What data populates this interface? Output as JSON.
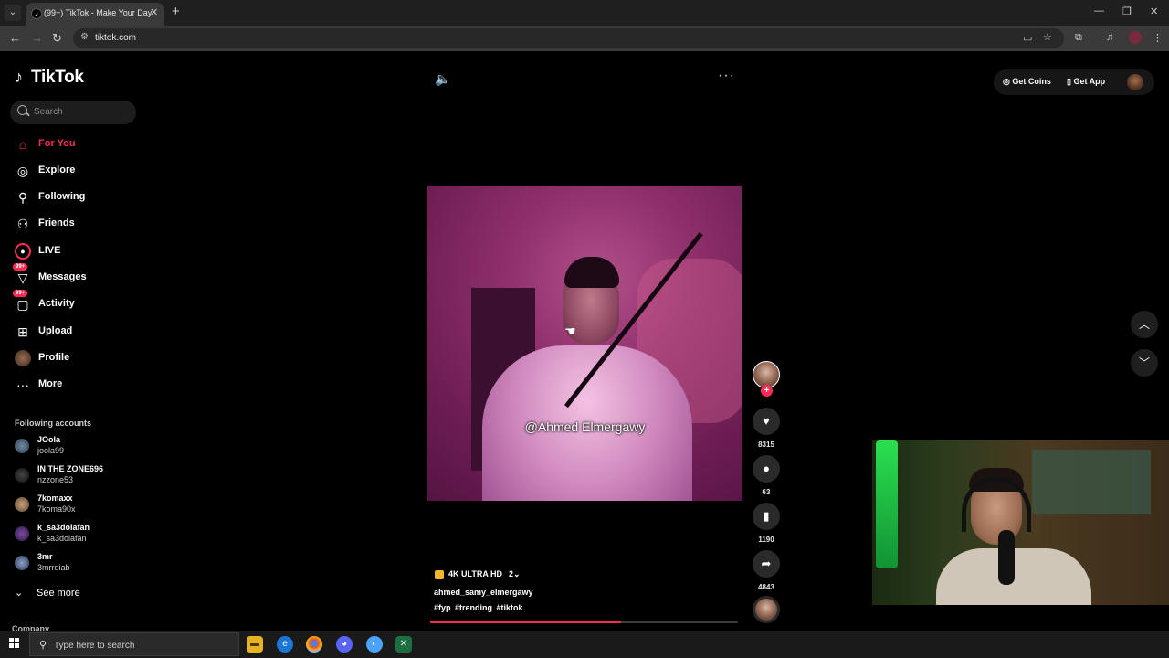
{
  "browser": {
    "tab_title": "(99+) TikTok - Make Your Day",
    "url": "tiktok.com"
  },
  "logo": {
    "text": "TikTok"
  },
  "search": {
    "placeholder": "Search"
  },
  "nav": {
    "for_you": "For You",
    "explore": "Explore",
    "following": "Following",
    "friends": "Friends",
    "live": "LIVE",
    "messages": "Messages",
    "messages_badge": "99+",
    "activity": "Activity",
    "activity_badge": "99+",
    "upload": "Upload",
    "profile": "Profile",
    "more": "More"
  },
  "following_accounts": {
    "title": "Following accounts",
    "items": [
      {
        "name": "JOola",
        "handle": "joola99"
      },
      {
        "name": "IN THE ZONE696",
        "handle": "nzzone53"
      },
      {
        "name": "7komaxx",
        "handle": "7koma90x"
      },
      {
        "name": "k_sa3dolafan",
        "handle": "k_sa3dolafan"
      },
      {
        "name": "3mr",
        "handle": "3mrrdiab"
      }
    ],
    "see_more": "See more"
  },
  "company_label": "Company",
  "video": {
    "overlay_caption": "@Ahmed Elmergawy",
    "quality_label": "4K ULTRA HD",
    "quality_count": "2",
    "author": "ahmed_samy_elmergawy",
    "hashtags": "#fyp #trending #tiktok",
    "progress_fraction": 0.62
  },
  "actions": {
    "likes": "8315",
    "comments": "63",
    "saves": "1190",
    "shares": "4843"
  },
  "top_right": {
    "get_coins": "Get Coins",
    "get_app": "Get App"
  },
  "taskbar": {
    "search_text": "Type here to search"
  },
  "colors": {
    "accent": "#fe2c55",
    "background": "#000000",
    "progress_track": "#3b3b3b"
  },
  "icons": [
    "tiktok-logo-icon",
    "search-icon",
    "home-icon",
    "compass-icon",
    "following-icon",
    "friends-icon",
    "live-icon",
    "messages-icon",
    "activity-icon",
    "upload-icon",
    "profile-icon",
    "more-icon",
    "volume-icon",
    "ellipsis-icon",
    "heart-icon",
    "comment-icon",
    "bookmark-icon",
    "share-icon",
    "chevron-up-icon",
    "chevron-down-icon"
  ]
}
